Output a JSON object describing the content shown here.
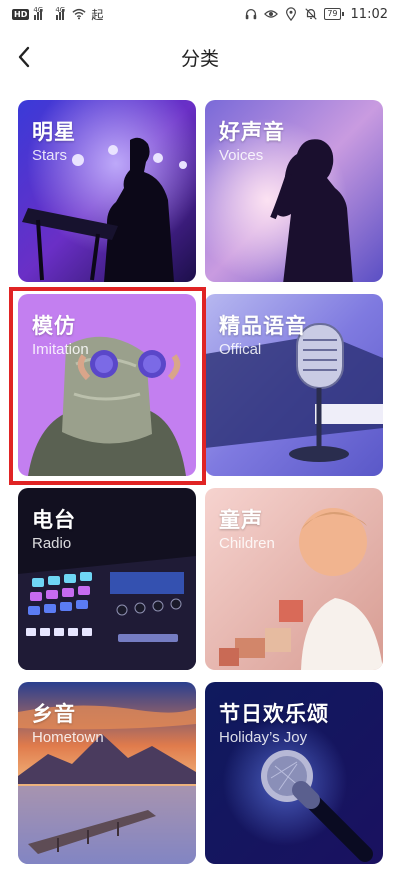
{
  "status_bar": {
    "hd": "HD",
    "net1": "4G",
    "net2": "4G",
    "extra": "起",
    "battery": "79",
    "time": "11:02"
  },
  "nav": {
    "title": "分类",
    "back_icon": "chevron-left-icon"
  },
  "categories": [
    {
      "zh": "明星",
      "en": "Stars"
    },
    {
      "zh": "好声音",
      "en": "Voices"
    },
    {
      "zh": "模仿",
      "en": "Imitation"
    },
    {
      "zh": "精品语音",
      "en": "Offical"
    },
    {
      "zh": "电台",
      "en": "Radio"
    },
    {
      "zh": "童声",
      "en": "Children"
    },
    {
      "zh": "乡音",
      "en": "Hometown"
    },
    {
      "zh": "节日欢乐颂",
      "en": "Holiday’s Joy"
    }
  ],
  "colors": {
    "highlight": "#e02424"
  }
}
